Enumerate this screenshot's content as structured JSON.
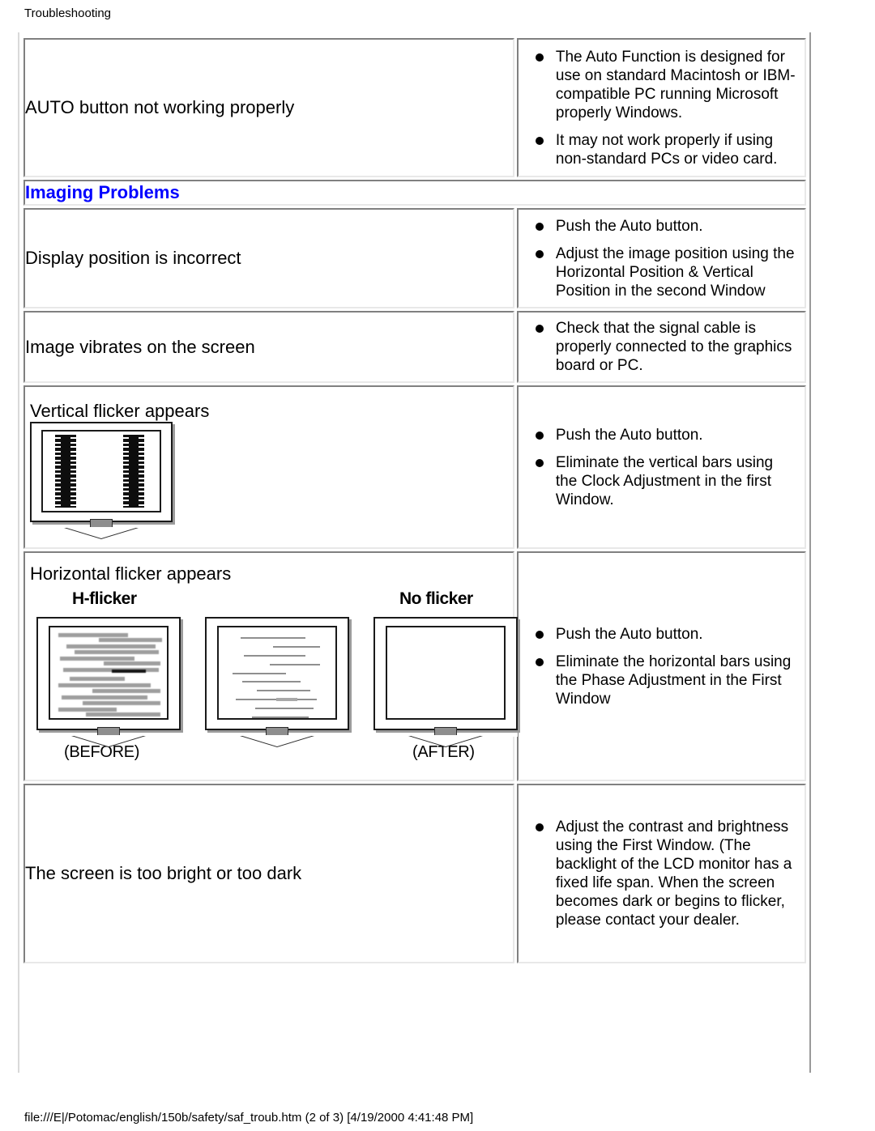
{
  "page": {
    "header": "Troubleshooting",
    "footer": "file:///E|/Potomac/english/150b/safety/saf_troub.htm (2 of 3) [4/19/2000 4:41:48 PM]",
    "accent_color": "#0000ff",
    "text_color": "#000000",
    "background_color": "#ffffff"
  },
  "section_banner": {
    "label": "Imaging Problems"
  },
  "rows": {
    "auto_button": {
      "label": "AUTO button not working properly",
      "bullets": [
        "The Auto Function is designed for use on standard Macintosh or IBM-compatible PC running Microsoft properly Windows.",
        "It may not work properly if using non-standard PCs or video card."
      ]
    },
    "display_position": {
      "label": "Display position is incorrect",
      "bullets": [
        "Push the Auto button.",
        "Adjust the image position using the Horizontal Position & Vertical Position in the second Window"
      ]
    },
    "image_vibrates": {
      "label": "Image vibrates on the screen",
      "bullets": [
        "Check that the signal cable is properly connected to the graphics board or PC."
      ]
    },
    "vertical_flicker": {
      "label": "Vertical flicker appears",
      "bullets": [
        "Push the Auto button.",
        "Eliminate the vertical bars using the Clock Adjustment in the first Window."
      ]
    },
    "horizontal_flicker": {
      "label": "Horizontal flicker appears",
      "captions": {
        "hflicker": "H-flicker",
        "noflicker": "No flicker",
        "before": "(BEFORE)",
        "after": "(AFTER)"
      },
      "bullets": [
        "Push the Auto button.",
        "Eliminate the horizontal bars using the Phase Adjustment in the First Window"
      ]
    },
    "brightness": {
      "label": "The screen is too bright or too dark",
      "bullets": [
        "Adjust the contrast and brightness using the First Window. (The backlight of the LCD monitor has a fixed life span. When the screen becomes dark or begins to flicker, please contact your dealer."
      ]
    }
  }
}
